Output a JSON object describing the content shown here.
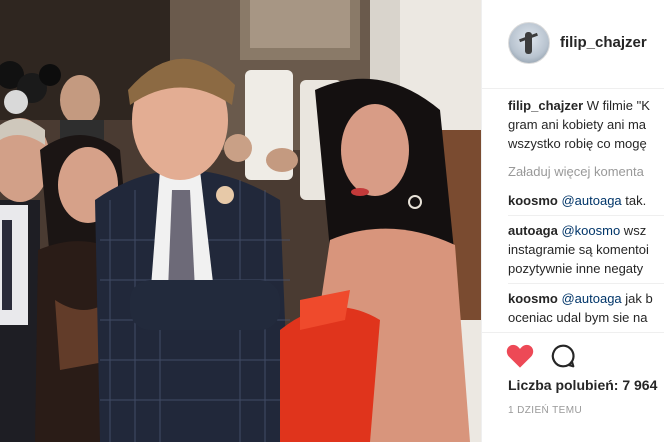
{
  "post": {
    "username": "filip_chajzer",
    "caption_user": "filip_chajzer",
    "caption_text_1": " W filmie \"K",
    "caption_text_2": "gram ani kobiety ani ma",
    "caption_text_3": "wszystko robię co mogę",
    "load_more": "Załaduj więcej komenta",
    "comments": [
      {
        "user": "koosmo",
        "mention": "@autoaga",
        "text": " tak."
      },
      {
        "user": "autoaga",
        "mention": "@koosmo",
        "text": " wsz",
        "line2": "instagramie są komentoi",
        "line3": "pozytywnie inne negaty"
      },
      {
        "user": "koosmo",
        "mention": "@autoaga",
        "text": " jak b",
        "line2": "oceniac udal bym sie na"
      }
    ],
    "likes": "Liczba polubień: 7 964",
    "time": "1 DZIEŃ TEMU"
  },
  "colors": {
    "like_red": "#ed4956",
    "mention": "#003569",
    "muted": "#999999"
  },
  "icons": {
    "like": "heart-icon",
    "comment": "comment-icon"
  }
}
